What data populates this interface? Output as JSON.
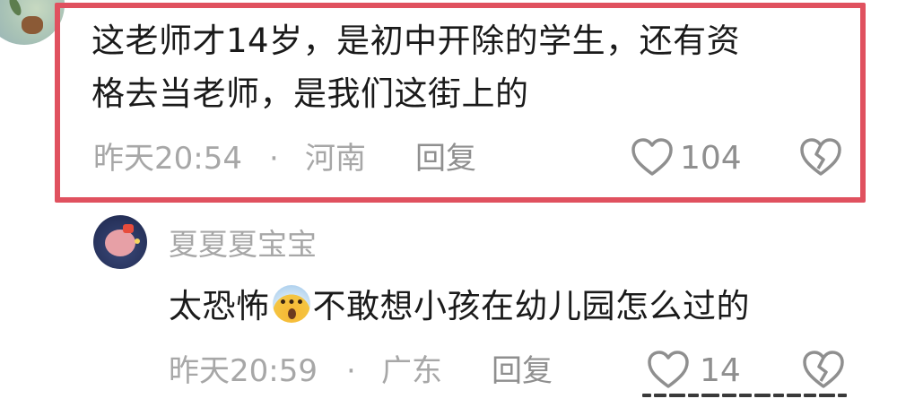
{
  "comment_1": {
    "text_line_1": "这老师才14岁，是初中开除的学生，还有资",
    "text_line_2": "格去当老师，是我们这街上的",
    "time": "昨天20:54",
    "separator": "·",
    "location": "河南",
    "reply_label": "回复",
    "like_count": "104"
  },
  "comment_2": {
    "username": "夏夏夏宝宝",
    "text_before_emoji": "太恐怖",
    "emoji": "fearful-face-emoji",
    "text_after_emoji": "不敢想小孩在幼儿园怎么过的",
    "time": "昨天20:59",
    "separator": "·",
    "location": "广东",
    "reply_label": "回复",
    "like_count": "14"
  },
  "colors": {
    "highlight_border": "#e0515f",
    "text_primary": "#1a1a1a",
    "text_secondary": "#a7a7a7",
    "text_tertiary": "#8f8f8f"
  },
  "icons": [
    "heart-outline-icon",
    "broken-heart-icon"
  ]
}
